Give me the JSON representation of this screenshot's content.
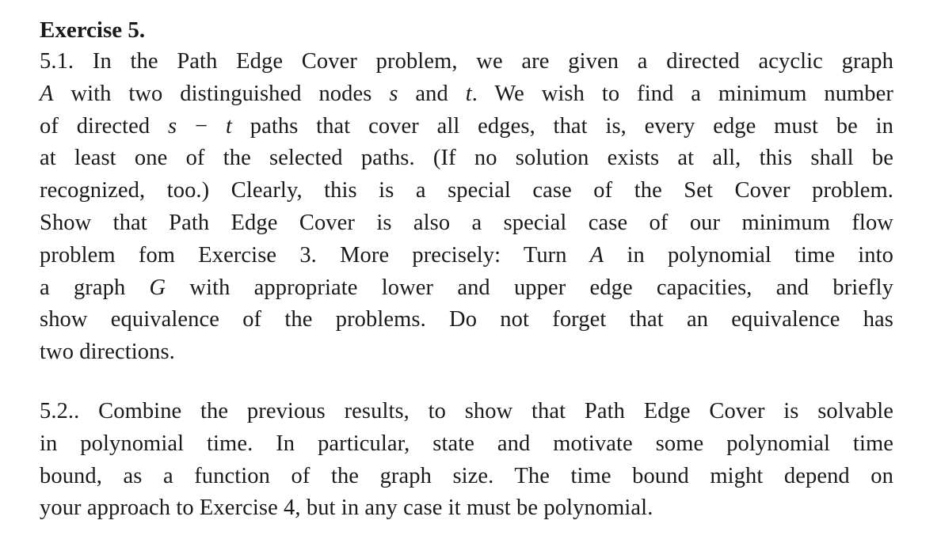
{
  "exercise": {
    "title": "Exercise 5.",
    "part1": {
      "lines": [
        "5.1. In the Path Edge Cover problem, we are given a directed acyclic graph",
        "A with two distinguished nodes s and t. We wish to find a minimum number",
        "of directed s − t paths that cover all edges, that is, every edge must be in",
        "at least one of the selected paths. (If no solution exists at all, this shall be",
        "recognized, too.) Clearly, this is a special case of the Set Cover problem.",
        "Show that Path Edge Cover is also a special case of our minimum flow",
        "problem fom Exercise 3. More precisely: Turn A in polynomial time into",
        "a graph G with appropriate lower and upper edge capacities, and briefly",
        "show equivalence of the problems. Do not forget that an equivalence has",
        "two directions."
      ]
    },
    "part2": {
      "lines": [
        "5.2.. Combine the previous results, to show that Path Edge Cover is solvable",
        "in polynomial time. In particular, state and motivate some polynomial time",
        "bound, as a function of the graph size. The time bound might depend on",
        "your approach to Exercise 4, but in any case it must be polynomial."
      ]
    }
  }
}
